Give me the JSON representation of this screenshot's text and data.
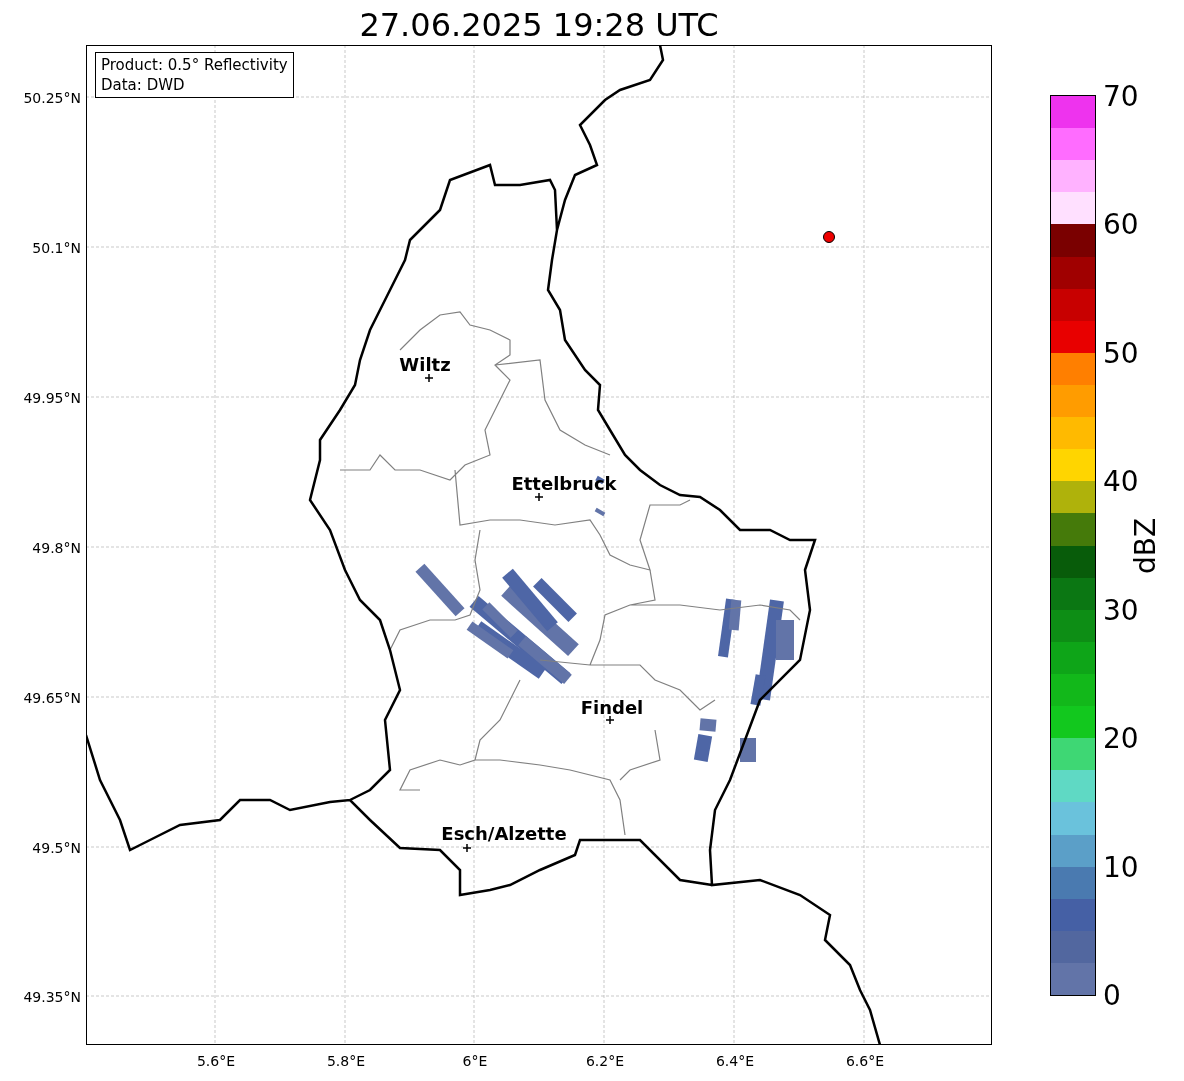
{
  "title": "27.06.2025 19:28 UTC",
  "info_box": [
    "Product: 0.5° Reflectivity",
    "Data: DWD"
  ],
  "map": {
    "lat_ticks": [
      "50.25°N",
      "50.1°N",
      "49.95°N",
      "49.8°N",
      "49.65°N",
      "49.5°N",
      "49.35°N"
    ],
    "lon_ticks": [
      "5.6°E",
      "5.8°E",
      "6°E",
      "6.2°E",
      "6.4°E",
      "6.6°E"
    ],
    "cities": [
      "Wiltz",
      "Ettelbruck",
      "Findel",
      "Esch/Alzette"
    ]
  },
  "colorbar": {
    "label": "dBZ",
    "ticks": [
      "70",
      "60",
      "50",
      "40",
      "30",
      "20",
      "10",
      "0"
    ],
    "segments": [
      {
        "color": "#ee33ee"
      },
      {
        "color": "#ff6cff"
      },
      {
        "color": "#ffb2ff"
      },
      {
        "color": "#ffe0ff"
      },
      {
        "color": "#7a0000"
      },
      {
        "color": "#a00000"
      },
      {
        "color": "#c80000"
      },
      {
        "color": "#e80000"
      },
      {
        "color": "#ff7f00"
      },
      {
        "color": "#ff9c00"
      },
      {
        "color": "#ffba00"
      },
      {
        "color": "#ffd500"
      },
      {
        "color": "#afb20b"
      },
      {
        "color": "#457a0a"
      },
      {
        "color": "#085c0a"
      },
      {
        "color": "#0b7713"
      },
      {
        "color": "#0d8e15"
      },
      {
        "color": "#0ea518"
      },
      {
        "color": "#12b81a"
      },
      {
        "color": "#12c81e"
      },
      {
        "color": "#3ed774"
      },
      {
        "color": "#5fd9c4"
      },
      {
        "color": "#6ac2dc"
      },
      {
        "color": "#5b9fc8"
      },
      {
        "color": "#4a7ab0"
      },
      {
        "color": "#4560a5"
      },
      {
        "color": "#52679f"
      },
      {
        "color": "#6274a8"
      }
    ]
  }
}
